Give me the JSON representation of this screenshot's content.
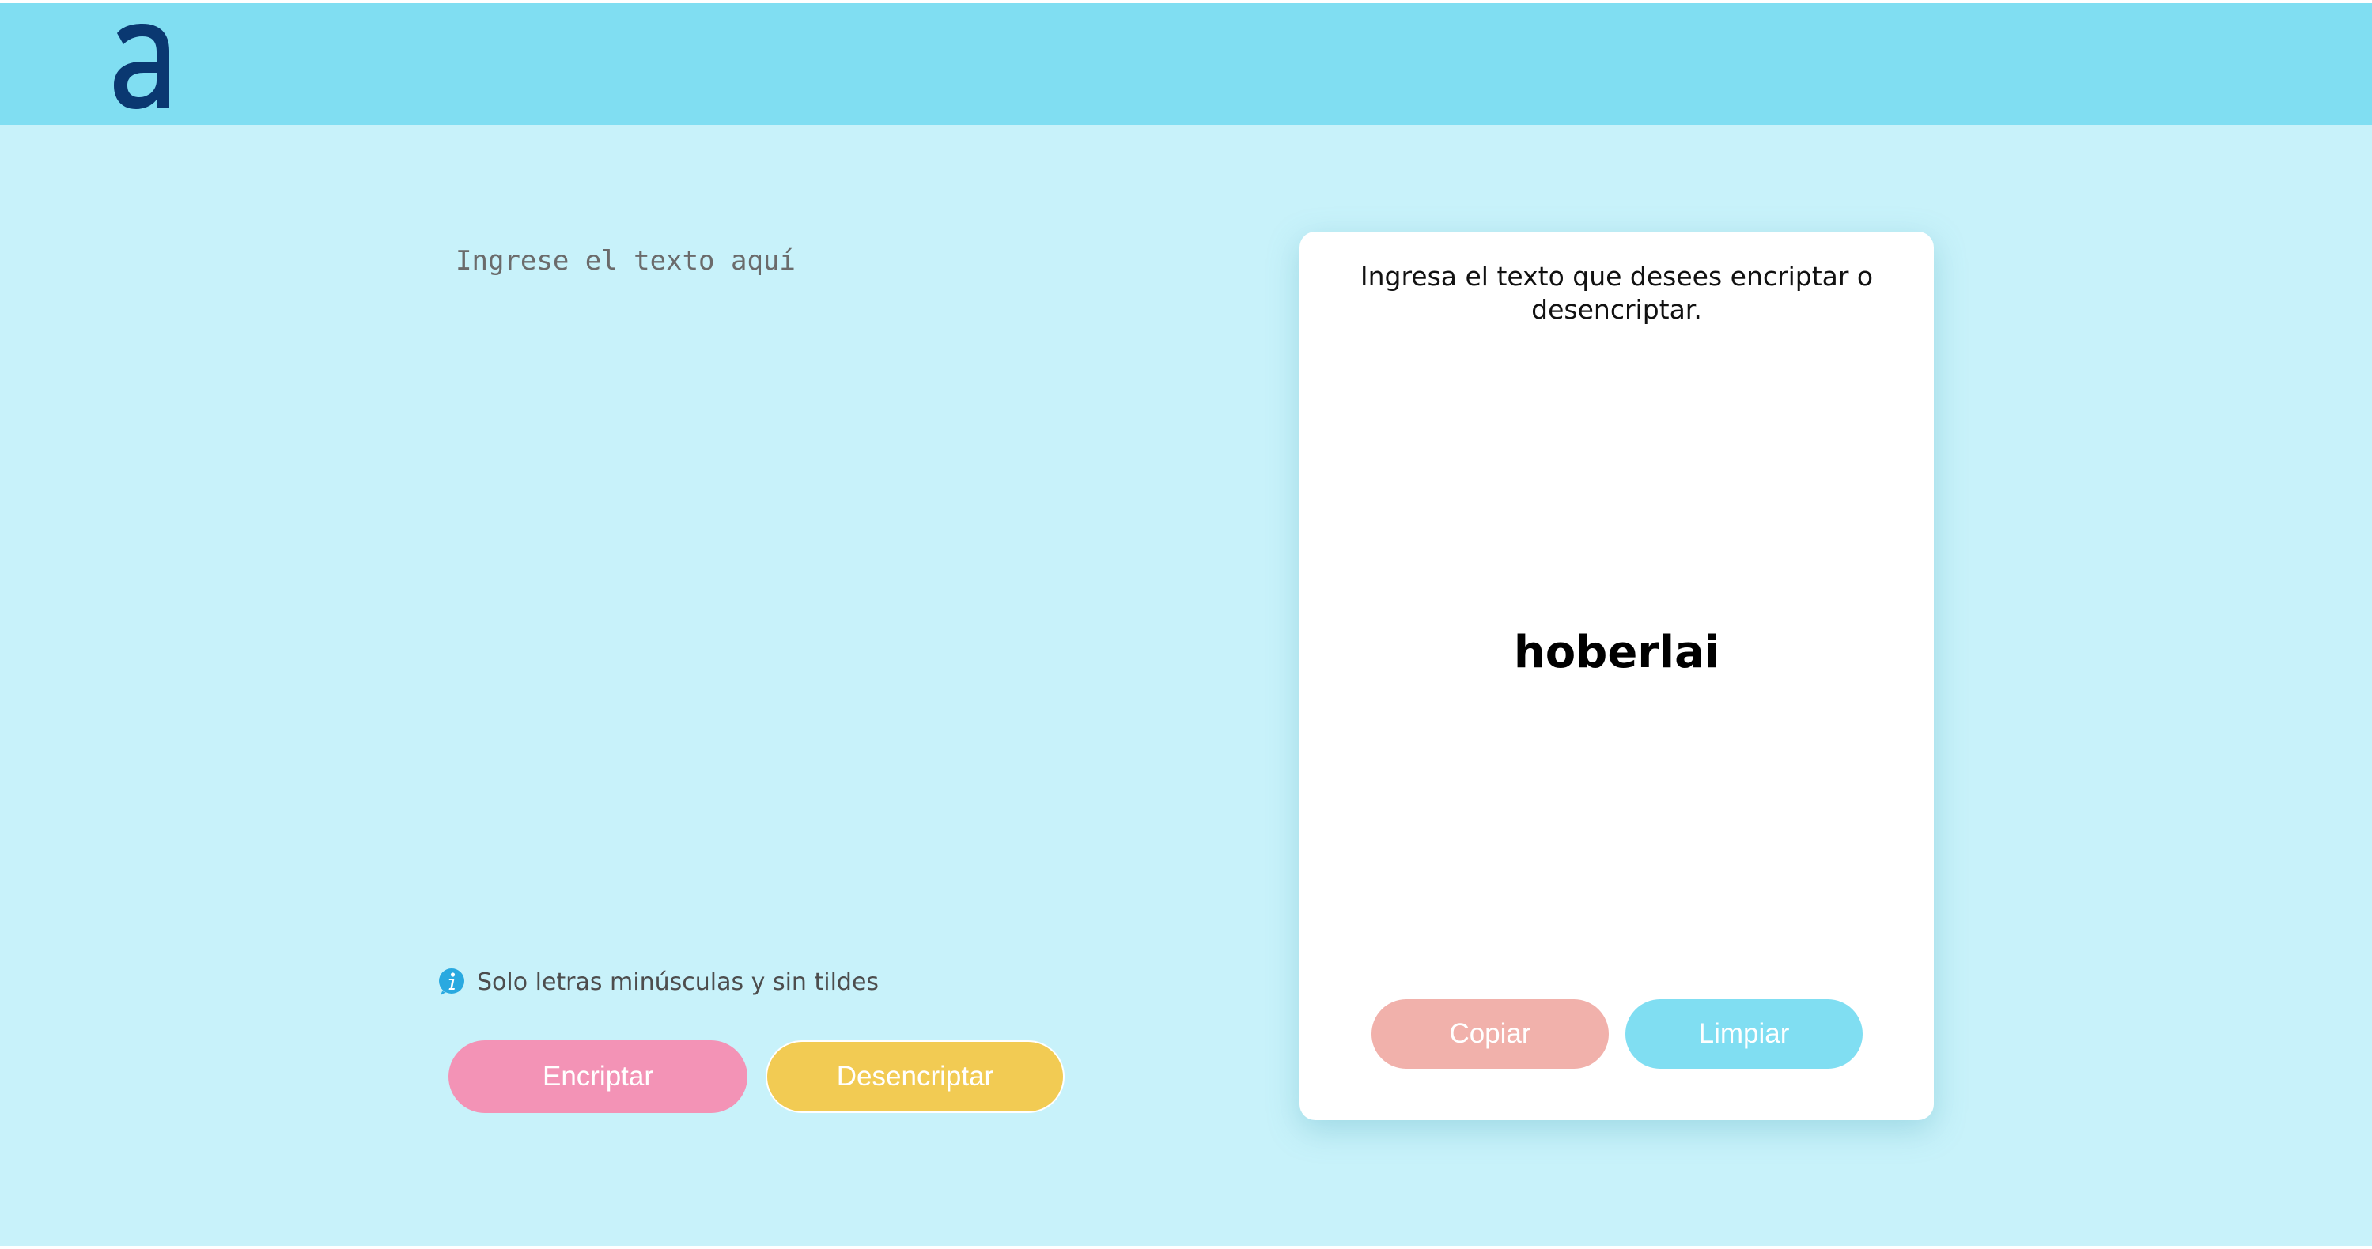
{
  "header": {
    "logo_name": "alura-logo"
  },
  "editor": {
    "placeholder": "Ingrese el texto aquí",
    "value": ""
  },
  "hint": {
    "icon": "info-icon",
    "text": "Solo letras minúsculas y sin tildes"
  },
  "actions": {
    "encrypt_label": "Encriptar",
    "decrypt_label": "Desencriptar"
  },
  "output": {
    "instruction": "Ingresa el texto que desees encriptar o desencriptar.",
    "result": "hoberlai",
    "copy_label": "Copiar",
    "clear_label": "Limpiar"
  },
  "colors": {
    "header_bg": "#80def2",
    "page_bg": "#c8f2fa",
    "encrypt_button": "#f393b6",
    "decrypt_button": "#f2cb53",
    "copy_button": "#f1b1ab",
    "clear_button": "#80def2",
    "logo": "#0a3871",
    "info_icon": "#29a9e0"
  }
}
